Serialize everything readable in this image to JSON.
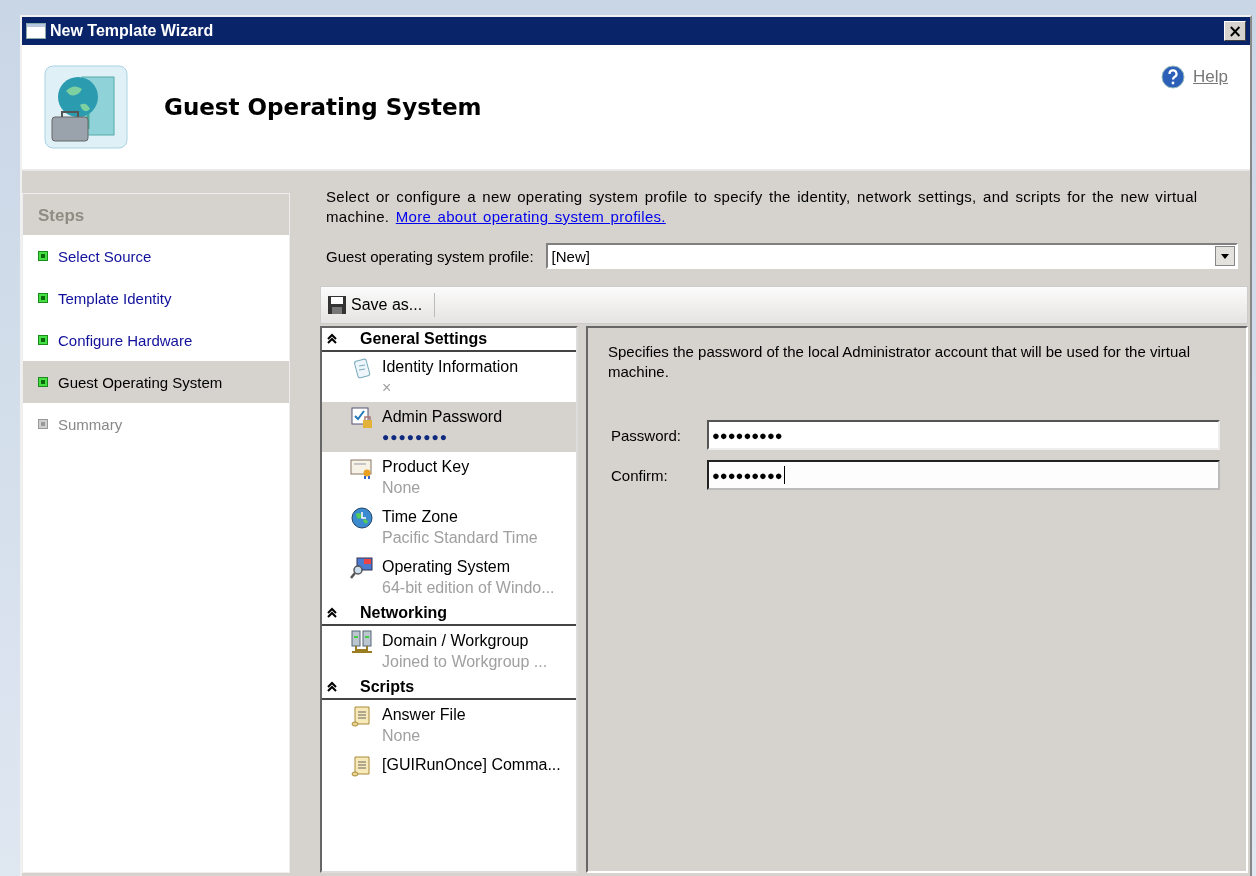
{
  "window": {
    "title": "New Template Wizard",
    "close": "×"
  },
  "header": {
    "title": "Guest Operating System",
    "help": "Help"
  },
  "steps": {
    "heading": "Steps",
    "items": [
      {
        "label": "Select Source",
        "completed": true,
        "selected": false
      },
      {
        "label": "Template Identity",
        "completed": true,
        "selected": false
      },
      {
        "label": "Configure Hardware",
        "completed": true,
        "selected": false
      },
      {
        "label": "Guest Operating System",
        "completed": true,
        "selected": true
      },
      {
        "label": "Summary",
        "completed": false,
        "selected": false
      }
    ]
  },
  "intro": {
    "text": "Select or configure a new operating system profile to specify the identity, network settings, and scripts for the new virtual machine.",
    "link": "More about operating system profiles."
  },
  "profile": {
    "label": "Guest operating system profile:",
    "value": "[New]"
  },
  "toolbar": {
    "save": "Save as..."
  },
  "settings": [
    {
      "title": "General Settings",
      "expanded": true,
      "items": [
        {
          "label": "Identity Information",
          "detail": "×",
          "kind": "clipboard",
          "selected": false
        },
        {
          "label": "Admin Password",
          "detail": "●●●●●●●●",
          "kind": "checklock",
          "selected": true
        },
        {
          "label": "Product Key",
          "detail": "None",
          "kind": "certificate",
          "selected": false
        },
        {
          "label": "Time Zone",
          "detail": "Pacific Standard Time",
          "kind": "globe",
          "selected": false
        },
        {
          "label": "Operating System",
          "detail": "64-bit edition of Windo...",
          "kind": "monitor",
          "selected": false
        }
      ]
    },
    {
      "title": "Networking",
      "expanded": true,
      "items": [
        {
          "label": "Domain / Workgroup",
          "detail": "Joined to Workgroup ...",
          "kind": "servers",
          "selected": false
        }
      ]
    },
    {
      "title": "Scripts",
      "expanded": true,
      "items": [
        {
          "label": "Answer File",
          "detail": "None",
          "kind": "scroll",
          "selected": false
        },
        {
          "label": "[GUIRunOnce] Comma...",
          "kind": "scroll",
          "selected": false
        }
      ]
    }
  ],
  "detail": {
    "description": "Specifies the password of the local Administrator account that will be used for the virtual machine.",
    "fields": [
      {
        "label": "Password:",
        "value": "●●●●●●●●●",
        "focused": false
      },
      {
        "label": "Confirm:",
        "value": "●●●●●●●●●",
        "focused": true
      }
    ]
  }
}
